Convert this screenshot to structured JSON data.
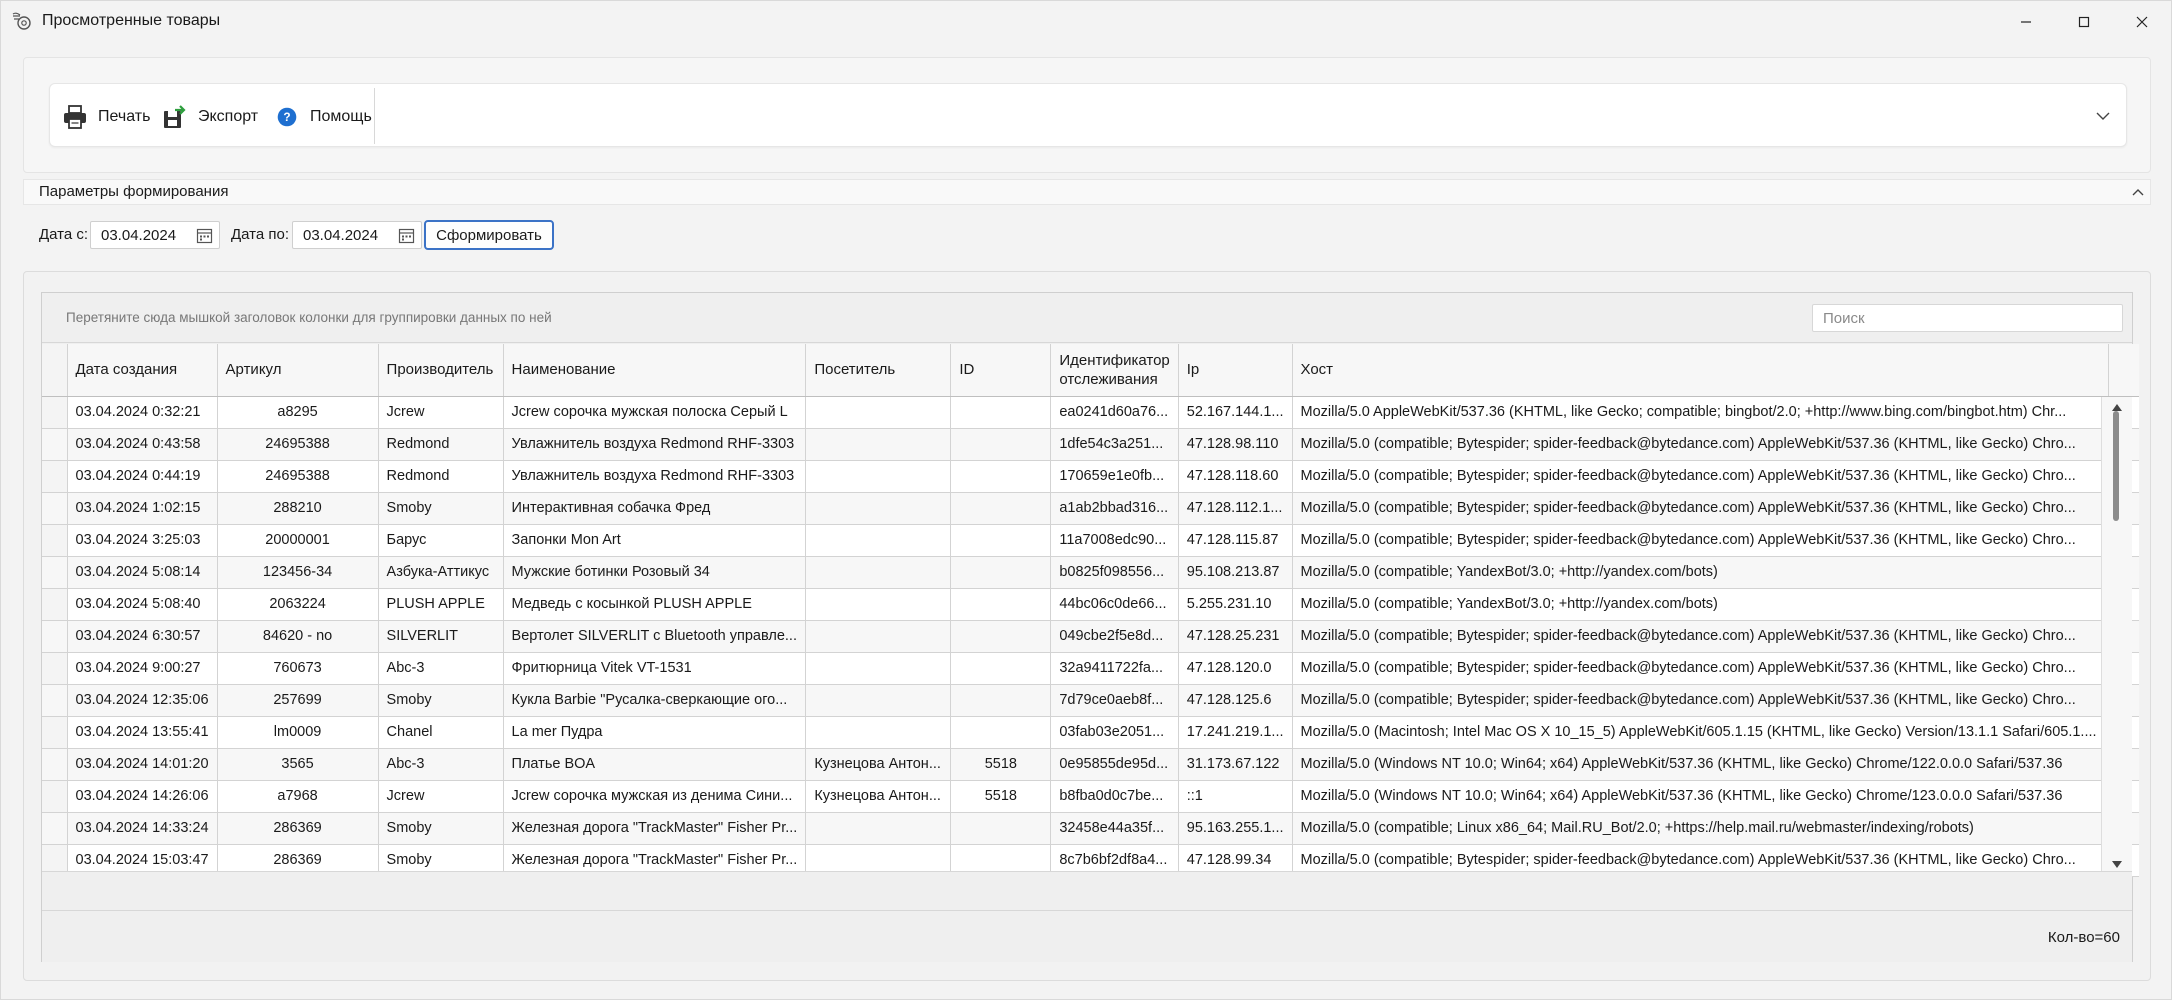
{
  "window": {
    "title": "Просмотренные товары"
  },
  "ribbon": {
    "print_label": "Печать",
    "export_label": "Экспорт",
    "help_label": "Помощь"
  },
  "params": {
    "header": "Параметры формирования",
    "date_from_label": "Дата с:",
    "date_from_value": "03.04.2024",
    "date_to_label": "Дата по:",
    "date_to_value": "03.04.2024",
    "form_button": "Сформировать"
  },
  "grid": {
    "group_hint": "Перетяните сюда мышкой заголовок колонки для группировки данных по ней",
    "search_placeholder": "Поиск",
    "columns": [
      "Дата создания",
      "Артикул",
      "Производитель",
      "Наименование",
      "Посетитель",
      "ID",
      "Идентификатор отслеживания",
      "Ip",
      "Хост"
    ],
    "rows": [
      [
        "03.04.2024 0:32:21",
        "a8295",
        "Jcrew",
        "Jcrew сорочка мужская полоска Серый L",
        "",
        "",
        "ea0241d60a76...",
        "52.167.144.1...",
        "Mozilla/5.0 AppleWebKit/537.36 (KHTML, like Gecko; compatible; bingbot/2.0; +http://www.bing.com/bingbot.htm) Chr..."
      ],
      [
        "03.04.2024 0:43:58",
        "24695388",
        "Redmond",
        "Увлажнитель воздуха Redmond RHF-3303",
        "",
        "",
        "1dfe54c3a251...",
        "47.128.98.110",
        "Mozilla/5.0 (compatible; Bytespider; spider-feedback@bytedance.com) AppleWebKit/537.36 (KHTML, like Gecko) Chro..."
      ],
      [
        "03.04.2024 0:44:19",
        "24695388",
        "Redmond",
        "Увлажнитель воздуха Redmond RHF-3303",
        "",
        "",
        "170659e1e0fb...",
        "47.128.118.60",
        "Mozilla/5.0 (compatible; Bytespider; spider-feedback@bytedance.com) AppleWebKit/537.36 (KHTML, like Gecko) Chro..."
      ],
      [
        "03.04.2024 1:02:15",
        "288210",
        "Smoby",
        "Интерактивная собачка Фред",
        "",
        "",
        "a1ab2bbad316...",
        "47.128.112.1...",
        "Mozilla/5.0 (compatible; Bytespider; spider-feedback@bytedance.com) AppleWebKit/537.36 (KHTML, like Gecko) Chro..."
      ],
      [
        "03.04.2024 3:25:03",
        "20000001",
        "Барус",
        "Запонки Mon Art",
        "",
        "",
        "11a7008edc90...",
        "47.128.115.87",
        "Mozilla/5.0 (compatible; Bytespider; spider-feedback@bytedance.com) AppleWebKit/537.36 (KHTML, like Gecko) Chro..."
      ],
      [
        "03.04.2024 5:08:14",
        "123456-34",
        "Азбука-Аттикус",
        "Мужские ботинки Розовый 34",
        "",
        "",
        "b0825f098556...",
        "95.108.213.87",
        "Mozilla/5.0 (compatible; YandexBot/3.0; +http://yandex.com/bots)"
      ],
      [
        "03.04.2024 5:08:40",
        "2063224",
        "PLUSH APPLE",
        "Медведь с косынкой PLUSH APPLE",
        "",
        "",
        "44bc06c0de66...",
        "5.255.231.10",
        "Mozilla/5.0 (compatible; YandexBot/3.0; +http://yandex.com/bots)"
      ],
      [
        "03.04.2024 6:30:57",
        "84620 - no",
        "SILVERLIT",
        "Вертолет  SILVERLIT с Bluetooth управле...",
        "",
        "",
        "049cbe2f5e8d...",
        "47.128.25.231",
        "Mozilla/5.0 (compatible; Bytespider; spider-feedback@bytedance.com) AppleWebKit/537.36 (KHTML, like Gecko) Chro..."
      ],
      [
        "03.04.2024 9:00:27",
        "760673",
        "Abc-3",
        "Фритюрница Vitek VT-1531",
        "",
        "",
        "32a9411722fa...",
        "47.128.120.0",
        "Mozilla/5.0 (compatible; Bytespider; spider-feedback@bytedance.com) AppleWebKit/537.36 (KHTML, like Gecko) Chro..."
      ],
      [
        "03.04.2024 12:35:06",
        "257699",
        "Smoby",
        "Кукла Barbie \"Русалка-сверкающие ого...",
        "",
        "",
        "7d79ce0aeb8f...",
        "47.128.125.6",
        "Mozilla/5.0 (compatible; Bytespider; spider-feedback@bytedance.com) AppleWebKit/537.36 (KHTML, like Gecko) Chro..."
      ],
      [
        "03.04.2024 13:55:41",
        "lm0009",
        "Chanel",
        "La mer Пудра",
        "",
        "",
        "03fab03e2051...",
        "17.241.219.1...",
        "Mozilla/5.0 (Macintosh; Intel Mac OS X 10_15_5) AppleWebKit/605.1.15 (KHTML, like Gecko) Version/13.1.1 Safari/605.1...."
      ],
      [
        "03.04.2024 14:01:20",
        "3565",
        "Abc-3",
        "Платье BOA",
        "Кузнецова Антон...",
        "5518",
        "0e95855de95d...",
        "31.173.67.122",
        "Mozilla/5.0 (Windows NT 10.0; Win64; x64) AppleWebKit/537.36 (KHTML, like Gecko) Chrome/122.0.0.0 Safari/537.36"
      ],
      [
        "03.04.2024 14:26:06",
        "a7968",
        "Jcrew",
        "Jcrew сорочка мужская из денима Сини...",
        "Кузнецова Антон...",
        "5518",
        "b8fba0d0c7be...",
        "::1",
        "Mozilla/5.0 (Windows NT 10.0; Win64; x64) AppleWebKit/537.36 (KHTML, like Gecko) Chrome/123.0.0.0 Safari/537.36"
      ],
      [
        "03.04.2024 14:33:24",
        "286369",
        "Smoby",
        "Железная дорога \"TrackMaster\" Fisher Pr...",
        "",
        "",
        "32458e44a35f...",
        "95.163.255.1...",
        "Mozilla/5.0 (compatible; Linux x86_64; Mail.RU_Bot/2.0; +https://help.mail.ru/webmaster/indexing/robots)"
      ],
      [
        "03.04.2024 15:03:47",
        "286369",
        "Smoby",
        "Железная дорога \"TrackMaster\" Fisher Pr...",
        "",
        "",
        "8c7b6bf2df8a4...",
        "47.128.99.34",
        "Mozilla/5.0 (compatible; Bytespider; spider-feedback@bytedance.com) AppleWebKit/537.36 (KHTML, like Gecko) Chro..."
      ]
    ],
    "count_label": "Кол-во=60"
  },
  "colors": {
    "accent_border": "#3b72c6",
    "help_icon": "#1e6fd0",
    "export_arrow": "#2e9e3e"
  },
  "icons": {
    "app": "app-icon",
    "print": "printer-icon",
    "export": "export-icon",
    "help": "help-icon",
    "calendar": "calendar-icon"
  }
}
